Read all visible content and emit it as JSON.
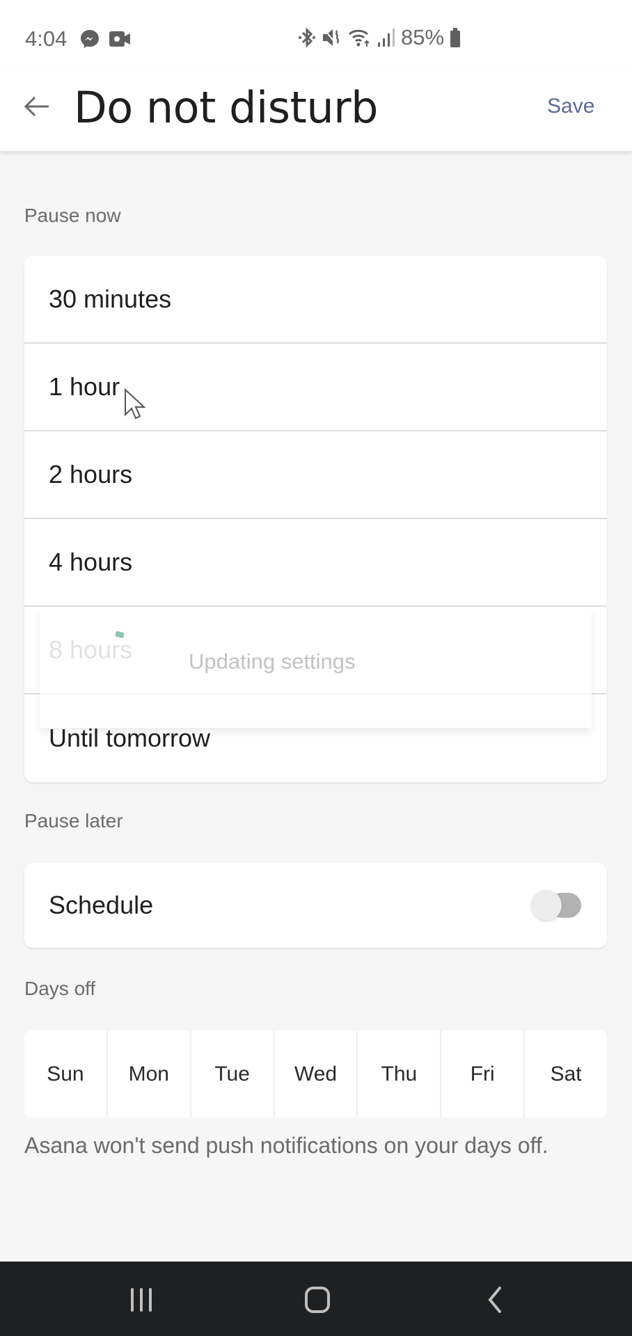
{
  "status_bar": {
    "time": "4:04",
    "left_icons": [
      "messenger-icon",
      "video-camera-icon"
    ],
    "right_icons": [
      "bluetooth-icon",
      "mute-icon",
      "wifi-icon",
      "signal-icon"
    ],
    "battery_text": "85%",
    "battery_icon": "battery-icon"
  },
  "app_bar": {
    "back_icon": "arrow-left-icon",
    "title": "Do not disturb",
    "save_label": "Save",
    "save_color": "#5b6a94"
  },
  "pause_now": {
    "label": "Pause now",
    "options": [
      {
        "label": "30 minutes"
      },
      {
        "label": "1 hour"
      },
      {
        "label": "2 hours"
      },
      {
        "label": "4 hours"
      },
      {
        "label": "8 hours"
      },
      {
        "label": "Until tomorrow"
      }
    ]
  },
  "toast": {
    "text": "Updating settings"
  },
  "pause_later": {
    "label": "Pause later",
    "schedule_label": "Schedule",
    "schedule_enabled": false
  },
  "days_off": {
    "label": "Days off",
    "days": [
      "Sun",
      "Mon",
      "Tue",
      "Wed",
      "Thu",
      "Fri",
      "Sat"
    ],
    "note": "Asana won't send push notifications on your days off."
  },
  "nav_bar": {
    "buttons": [
      "recent-apps-icon",
      "home-icon",
      "back-icon"
    ]
  }
}
